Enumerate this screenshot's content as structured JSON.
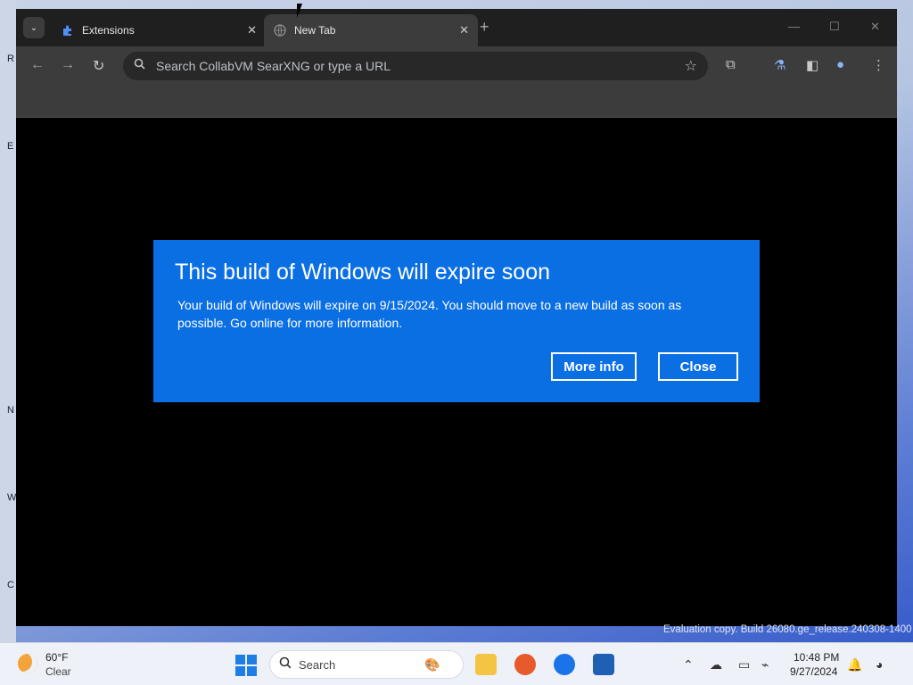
{
  "desktop": {
    "glyphs": [
      "R",
      "E",
      "N",
      "W",
      "C"
    ]
  },
  "browser": {
    "tabs": [
      {
        "title": "Extensions",
        "icon": "puzzle-icon"
      },
      {
        "title": "New Tab",
        "icon": "globe-icon"
      }
    ],
    "omnibox_placeholder": "Search CollabVM SearXNG or type a URL"
  },
  "dialog": {
    "title": "This build of Windows will expire soon",
    "body": "Your build of Windows will expire on 9/15/2024. You should move to a new build as soon as possible. Go online for more information.",
    "more_info_label": "More info",
    "close_label": "Close",
    "background_color": "#0b6fe4"
  },
  "watermark": "Evaluation copy. Build 26080.ge_release.240308-1400",
  "taskbar": {
    "weather_temp": "60°F",
    "weather_condition": "Clear",
    "search_label": "Search",
    "time": "10:48 PM",
    "date": "9/27/2024"
  }
}
